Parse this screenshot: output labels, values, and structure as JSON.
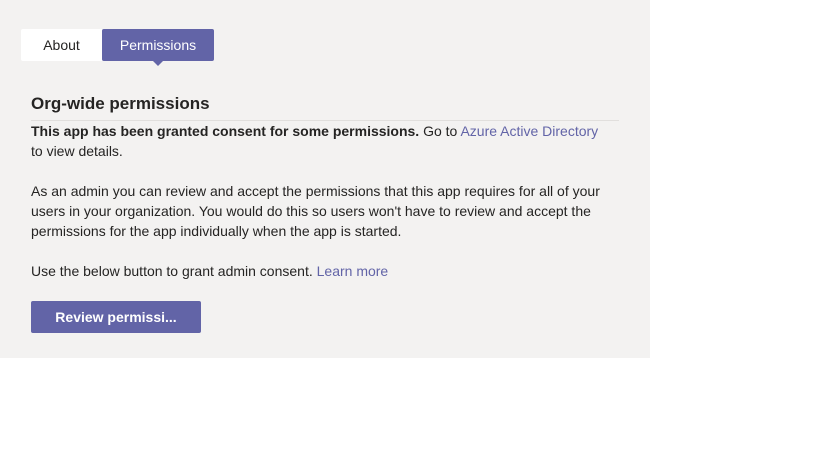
{
  "tabs": [
    {
      "label": "About",
      "selected": false
    },
    {
      "label": "Permissions",
      "selected": true
    }
  ],
  "section": {
    "title": "Org-wide permissions"
  },
  "consent_notice": {
    "bold_text": "This app has been granted consent for some permissions.",
    "text_before_link": " Go to ",
    "link_text": "Azure Active Directory",
    "text_after_link": " to view details."
  },
  "admin_description": "As an admin you can review and accept the permissions that this app requires for all of your users in your organization. You would do this so users won't have to review and accept the permissions for the app individually when the app is started.",
  "grant_instruction": {
    "text": "Use the below button to grant admin consent. ",
    "link_text": "Learn more"
  },
  "review_button": {
    "label": "Review permissi..."
  },
  "colors": {
    "accent": "#6264a7",
    "panel_background": "#f3f2f1",
    "text": "#252423"
  }
}
